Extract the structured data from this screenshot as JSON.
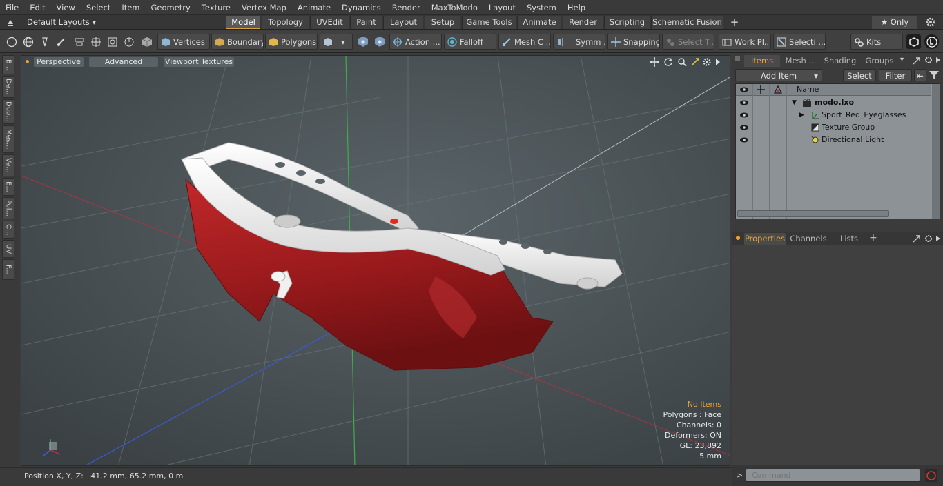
{
  "menu": [
    "File",
    "Edit",
    "View",
    "Select",
    "Item",
    "Geometry",
    "Texture",
    "Vertex Map",
    "Animate",
    "Dynamics",
    "Render",
    "MaxToModo",
    "Layout",
    "System",
    "Help"
  ],
  "layouts_dropdown": "Default Layouts ▾",
  "layout_tabs": [
    "Model",
    "Topology",
    "UVEdit",
    "Paint",
    "Layout",
    "Setup",
    "Game Tools",
    "Animate",
    "Render",
    "Scripting",
    "Schematic Fusion"
  ],
  "active_layout": "Model",
  "add_tab_glyph": "+",
  "only_button": "★ Only",
  "toolbar": {
    "vertices": "Vertices",
    "boundary": "Boundary",
    "polygons": "Polygons",
    "action": "Action ...",
    "falloff": "Falloff",
    "mesh": "Mesh C ...",
    "symm": "Symm ...",
    "snapping": "Snapping",
    "select_t": "Select T...",
    "work_pl": "Work Pl...",
    "selecti": "Selecti ...",
    "kits": "Kits"
  },
  "left_tabs": [
    "B...",
    "De...",
    "Dup...",
    "Mes...",
    "Ve...",
    "E...",
    "Pol...",
    "C...",
    "UV",
    "F..."
  ],
  "viewport": {
    "perspective": "Perspective",
    "advanced": "Advanced",
    "textures": "Viewport Textures",
    "info": {
      "no_items": "No Items",
      "polygons": "Polygons : Face",
      "channels": "Channels: 0",
      "deformers": "Deformers: ON",
      "gl": "GL: 23,892",
      "scale": "5 mm"
    },
    "axis_colors": {
      "x": "#c0303a",
      "y": "#3fae4a",
      "z": "#3b5bd6"
    }
  },
  "status": {
    "position": "Position X, Y, Z:   41.2 mm, 65.2 mm, 0 m"
  },
  "items_panel": {
    "tabs": [
      "Items",
      "Mesh ...",
      "Shading",
      "Groups"
    ],
    "add_item": "Add Item",
    "select": "Select",
    "filter": "Filter",
    "column_name": "Name",
    "items": [
      {
        "name": "modo.lxo",
        "bold": true
      },
      {
        "name": "Sport_Red_Eyeglasses"
      },
      {
        "name": "Texture Group"
      },
      {
        "name": "Directional Light"
      }
    ]
  },
  "props_panel": {
    "tabs": [
      "Properties",
      "Channels",
      "Lists"
    ],
    "add_tab_glyph": "+"
  },
  "command": {
    "placeholder": "Command"
  },
  "colors": {
    "accent": "#e9a23b",
    "lens": "#a01a1c",
    "frame": "#f2f2f2"
  }
}
